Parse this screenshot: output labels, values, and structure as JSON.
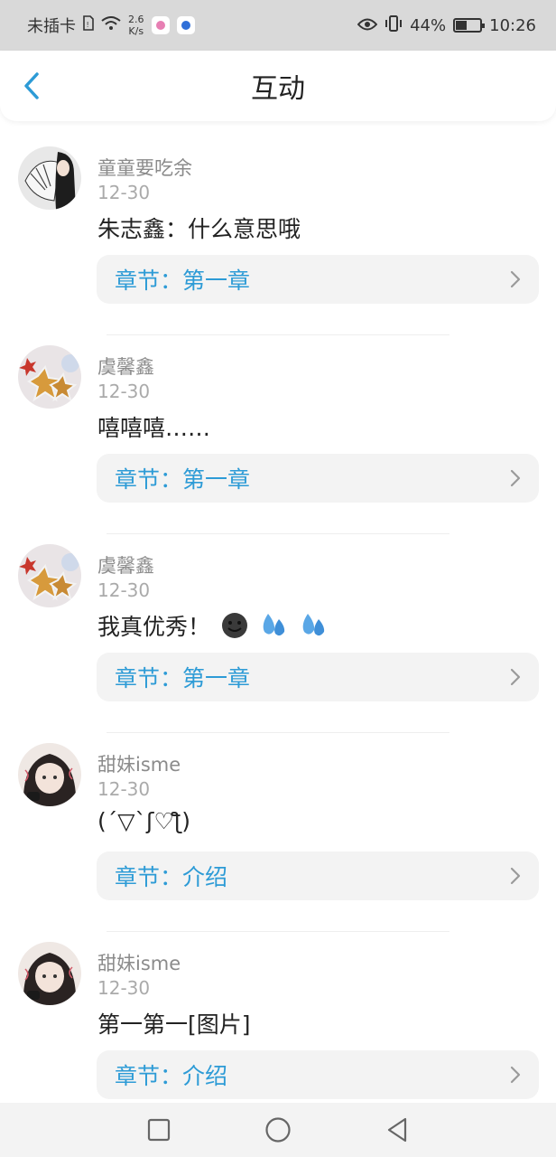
{
  "status_bar": {
    "carrier": "未插卡",
    "speed_value": "2.6",
    "speed_unit": "K/s",
    "battery": "44%",
    "time": "10:26"
  },
  "header": {
    "title": "互动"
  },
  "comments": [
    {
      "name": "童童要吃余",
      "date": "12-30",
      "text": "朱志鑫：什么意思哦",
      "chapter": "章节：第一章",
      "emojis": []
    },
    {
      "name": "虞馨鑫",
      "date": "12-30",
      "text": "嘻嘻嘻……",
      "chapter": "章节：第一章",
      "emojis": []
    },
    {
      "name": "虞馨鑫",
      "date": "12-30",
      "text": "我真优秀！",
      "chapter": "章节：第一章",
      "emojis": [
        "grinning-dark-emoji",
        "sweat-droplets-emoji",
        "sweat-droplets-emoji"
      ]
    },
    {
      "name": "甜妹isme",
      "date": "12-30",
      "text": "(´▽`ʃ♡ƪ)",
      "chapter": "章节：介绍",
      "emojis": []
    },
    {
      "name": "甜妹isme",
      "date": "12-30",
      "text": "第一第一[图片]",
      "chapter": "章节：介绍",
      "emojis": []
    }
  ],
  "colors": {
    "accent": "#2d9bd6",
    "status_bar_bg": "#d9d9d9",
    "chapter_bg": "#f3f3f3"
  },
  "nav_bar": {
    "icons": [
      "square-icon",
      "circle-home-icon",
      "triangle-back-icon"
    ]
  }
}
